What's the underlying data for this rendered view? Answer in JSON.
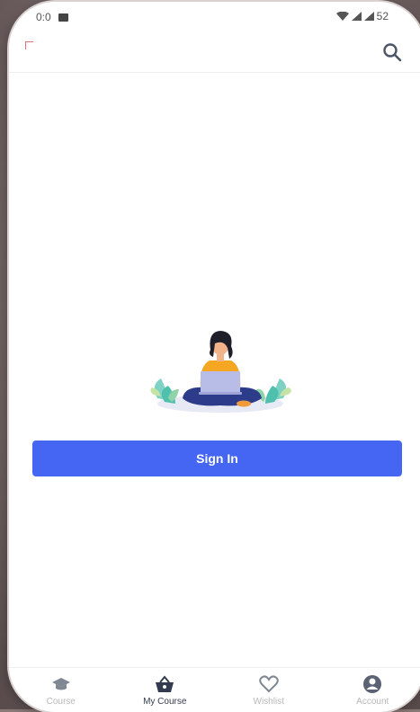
{
  "status_bar": {
    "time_partial": "0:0",
    "battery_partial": "52"
  },
  "app_bar": {
    "search_icon": "search-icon"
  },
  "main": {
    "illustration": "person-with-laptop-illustration",
    "signin_label": "Sign In"
  },
  "bottom_nav": {
    "items": [
      {
        "label": "Course",
        "icon": "graduation-cap-icon",
        "active": false
      },
      {
        "label": "My Course",
        "icon": "basket-icon",
        "active": true
      },
      {
        "label": "Wishlist",
        "icon": "heart-icon",
        "active": false
      },
      {
        "label": "Account",
        "icon": "account-icon",
        "active": false
      }
    ]
  },
  "colors": {
    "primary": "#4466f2",
    "nav_active": "#333c4e",
    "nav_inactive": "#b8b8b8"
  }
}
